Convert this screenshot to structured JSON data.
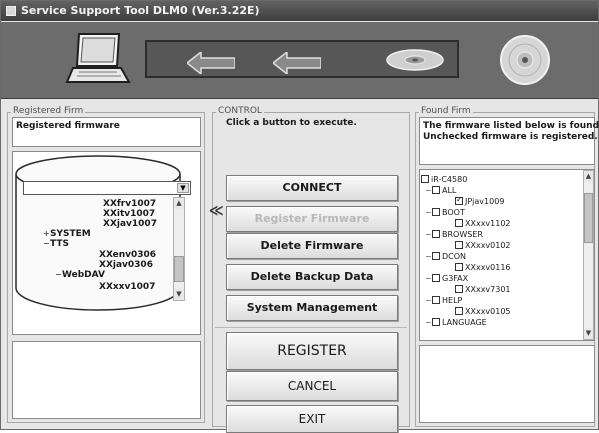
{
  "window": {
    "title": "Service Support Tool DLM0 (Ver.3.22E)"
  },
  "registered_panel": {
    "group_label": "Registered Firm",
    "header": "Registered firmware",
    "tree": [
      {
        "label": "XXfrv1007"
      },
      {
        "label": "XXitv1007"
      },
      {
        "label": "XXjav1007"
      },
      {
        "label": "SYSTEM"
      },
      {
        "label": "TTS"
      },
      {
        "label": "XXenv0306"
      },
      {
        "label": "XXjav0306"
      },
      {
        "label": "WebDAV"
      },
      {
        "label": "XXxxv1007"
      }
    ]
  },
  "control_panel": {
    "group_label": "CONTROL",
    "header": "Click a button to execute.",
    "buttons": {
      "connect": "CONNECT",
      "register_firmware": "Register Firmware",
      "delete_firmware": "Delete Firmware",
      "delete_backup": "Delete Backup Data",
      "system_management": "System Management",
      "register": "REGISTER",
      "cancel": "CANCEL",
      "exit": "EXIT"
    },
    "transfer_arrow": "≪"
  },
  "found_panel": {
    "group_label": "Found Firm",
    "header_line1": "The firmware listed below is found.",
    "header_line2": "Unchecked firmware is registered.",
    "tree": [
      {
        "label": "iR-C4580",
        "checked": false
      },
      {
        "label": "ALL",
        "checked": false
      },
      {
        "label": "JPjav1009",
        "checked": true
      },
      {
        "label": "BOOT",
        "checked": false
      },
      {
        "label": "XXxxv1102",
        "checked": false
      },
      {
        "label": "BROWSER",
        "checked": false
      },
      {
        "label": "XXxxv0102",
        "checked": false
      },
      {
        "label": "DCON",
        "checked": false
      },
      {
        "label": "XXxxv0116",
        "checked": false
      },
      {
        "label": "G3FAX",
        "checked": false
      },
      {
        "label": "XXxxv7301",
        "checked": false
      },
      {
        "label": "HELP",
        "checked": false
      },
      {
        "label": "XXxxv0105",
        "checked": false
      },
      {
        "label": "LANGUAGE",
        "checked": false
      }
    ]
  },
  "icons": {
    "laptop": "laptop-icon",
    "arrow": "left-arrow-icon",
    "disc": "disc-icon"
  },
  "colors": {
    "titlebar": "#4a4a4a",
    "banner": "#6c6c6c",
    "window": "#e6e6e6"
  }
}
